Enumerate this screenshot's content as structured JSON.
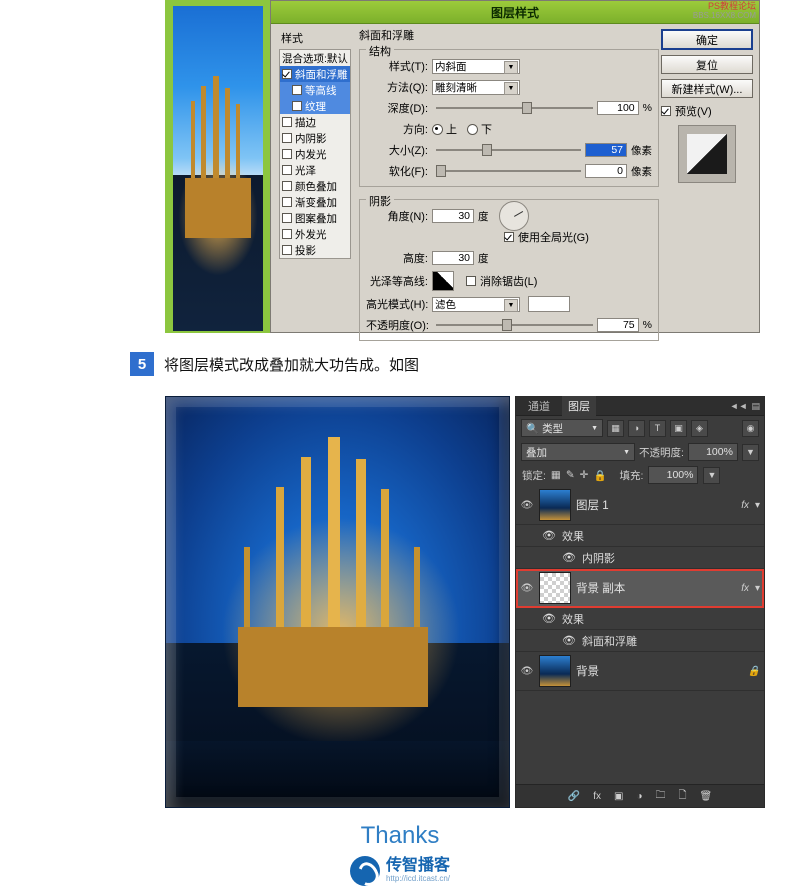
{
  "watermark": {
    "line1": "PS教程论坛",
    "line2": "BBS.16XX8.COM"
  },
  "dialog": {
    "title": "图层样式",
    "styles_header": "样式",
    "styles": [
      {
        "label": "混合选项:默认",
        "checkbox": false,
        "checked": false,
        "selected": false,
        "indent": false
      },
      {
        "label": "斜面和浮雕",
        "checkbox": true,
        "checked": true,
        "selected": true,
        "indent": false
      },
      {
        "label": "等高线",
        "checkbox": true,
        "checked": false,
        "selected": true,
        "indent": true
      },
      {
        "label": "纹理",
        "checkbox": true,
        "checked": false,
        "selected": true,
        "indent": true
      },
      {
        "label": "描边",
        "checkbox": true,
        "checked": false,
        "selected": false,
        "indent": false
      },
      {
        "label": "内阴影",
        "checkbox": true,
        "checked": false,
        "selected": false,
        "indent": false
      },
      {
        "label": "内发光",
        "checkbox": true,
        "checked": false,
        "selected": false,
        "indent": false
      },
      {
        "label": "光泽",
        "checkbox": true,
        "checked": false,
        "selected": false,
        "indent": false
      },
      {
        "label": "颜色叠加",
        "checkbox": true,
        "checked": false,
        "selected": false,
        "indent": false
      },
      {
        "label": "渐变叠加",
        "checkbox": true,
        "checked": false,
        "selected": false,
        "indent": false
      },
      {
        "label": "图案叠加",
        "checkbox": true,
        "checked": false,
        "selected": false,
        "indent": false
      },
      {
        "label": "外发光",
        "checkbox": true,
        "checked": false,
        "selected": false,
        "indent": false
      },
      {
        "label": "投影",
        "checkbox": true,
        "checked": false,
        "selected": false,
        "indent": false
      }
    ],
    "section_bevel": "斜面和浮雕",
    "group_structure": "结构",
    "fields": {
      "style_label": "样式(T):",
      "style_value": "内斜面",
      "technique_label": "方法(Q):",
      "technique_value": "雕刻清晰",
      "depth_label": "深度(D):",
      "depth_value": "100",
      "depth_unit": "%",
      "direction_label": "方向:",
      "direction_up": "上",
      "direction_down": "下",
      "size_label": "大小(Z):",
      "size_value": "57",
      "size_unit": "像素",
      "soften_label": "软化(F):",
      "soften_value": "0",
      "soften_unit": "像素"
    },
    "group_shading": "阴影",
    "shading": {
      "angle_label": "角度(N):",
      "angle_value": "30",
      "angle_unit": "度",
      "global_light": "使用全局光(G)",
      "altitude_label": "高度:",
      "altitude_value": "30",
      "altitude_unit": "度",
      "gloss_label": "光泽等高线:",
      "antialias": "消除锯齿(L)",
      "highlight_label": "高光模式(H):",
      "highlight_value": "滤色",
      "opacity_label": "不透明度(O):",
      "opacity_value": "75",
      "opacity_unit": "%"
    },
    "buttons": {
      "ok": "确定",
      "cancel": "复位",
      "new_style": "新建样式(W)...",
      "preview": "预览(V)"
    }
  },
  "step": {
    "number": "5",
    "text": "将图层模式改成叠加就大功告成。如图"
  },
  "layers_panel": {
    "tabs": [
      {
        "label": "通道",
        "active": false
      },
      {
        "label": "图层",
        "active": true
      }
    ],
    "filter_label": "类型",
    "blend_mode": "叠加",
    "opacity_label": "不透明度:",
    "opacity_value": "100%",
    "lock_label": "锁定:",
    "fill_label": "填充:",
    "fill_value": "100%",
    "layers": [
      {
        "name": "图层 1",
        "thumb": "photo",
        "fx": "fx",
        "selected": false,
        "highlighted": false,
        "effects_label": "效果",
        "effect_items": [
          "内阴影"
        ]
      },
      {
        "name": "背景 副本",
        "thumb": "checker",
        "fx": "fx",
        "selected": true,
        "highlighted": true,
        "effects_label": "效果",
        "effect_items": [
          "斜面和浮雕"
        ]
      },
      {
        "name": "背景",
        "thumb": "photo",
        "fx": "",
        "locked": true,
        "selected": false,
        "highlighted": false,
        "effects_label": "",
        "effect_items": []
      }
    ],
    "bottom_icons": [
      "link-icon",
      "fx-icon",
      "mask-icon",
      "adjustment-icon",
      "folder-icon",
      "new-layer-icon",
      "delete-icon"
    ]
  },
  "footer": {
    "thanks": "Thanks",
    "brand_cn": "传智播客",
    "brand_url": "http://icd.itcast.cn/"
  }
}
